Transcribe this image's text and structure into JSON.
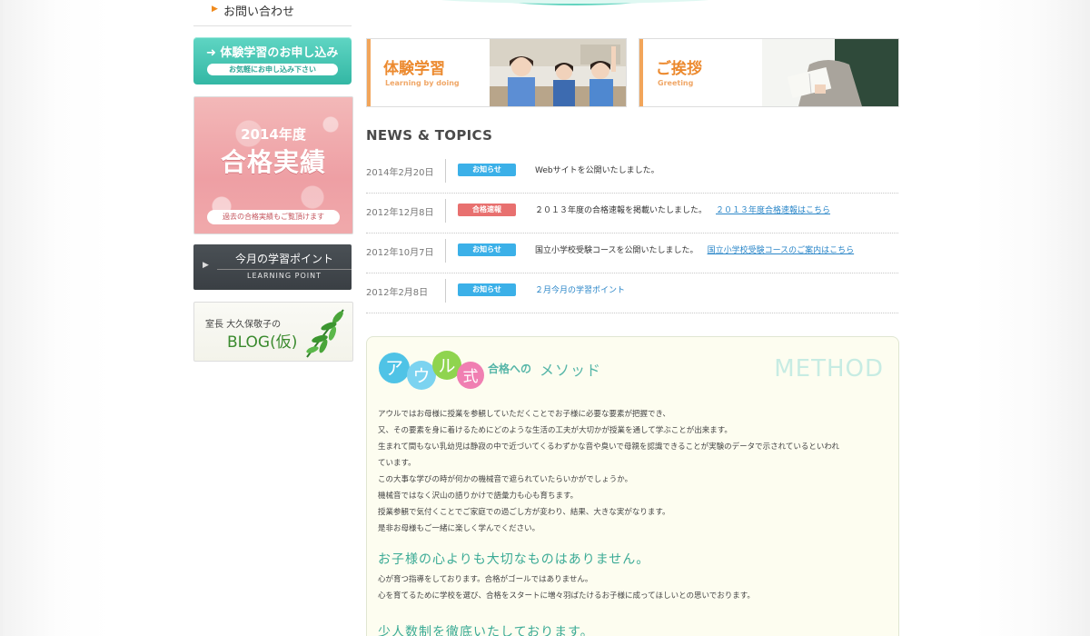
{
  "sidebar": {
    "contact_label": "お問い合わせ",
    "trial_button": {
      "title": "体験学習のお申し込み",
      "sub": "お気軽にお申し込み下さい"
    },
    "results": {
      "year": "2014年度",
      "title": "合格実績",
      "sub": "過去の合格実績もご覧頂けます"
    },
    "learning_point": {
      "title": "今月の学習ポイント",
      "sub": "LEARNING POINT"
    },
    "blog": {
      "title": "室長 大久保敬子の",
      "sub": "BLOG(仮)"
    }
  },
  "banners": [
    {
      "title": "体験学習",
      "sub": "Learning by doing"
    },
    {
      "title": "ご挨拶",
      "sub": "Greeting"
    }
  ],
  "news": {
    "title": "NEWS & TOPICS",
    "items": [
      {
        "date": "2014年2月20日",
        "badge": "お知らせ",
        "text": "Webサイトを公開いたしました。",
        "link": ""
      },
      {
        "date": "2012年12月8日",
        "badge": "合格速報",
        "text": "２０１３年度の合格速報を掲載いたしました。",
        "link": "２０１３年度合格速報はこちら"
      },
      {
        "date": "2012年10月7日",
        "badge": "お知らせ",
        "text": "国立小学校受験コースを公開いたしました。",
        "link": "国立小学校受験コースのご案内はこちら"
      },
      {
        "date": "2012年2月8日",
        "badge": "お知らせ",
        "text": "",
        "link": "２月今月の学習ポイント"
      }
    ]
  },
  "method": {
    "logo_chars": [
      "ア",
      "ウ",
      "ル",
      "式"
    ],
    "logo_sub": "合格への",
    "logo_sub2": "メソッド",
    "watermark": "METHOD",
    "paragraphs": [
      "アウルではお母様に授業を参観していただくことでお子様に必要な要素が把握でき、",
      "又、その要素を身に着けるためにどのような生活の工夫が大切かが授業を通して学ぶことが出来ます。",
      "生まれて間もない乳幼児は静寂の中で近づいてくるわずかな音や臭いで母親を認識できることが実験のデータで示されているといわれ",
      "ています。",
      "この大事な学びの時が何かの機械音で遮られていたらいかがでしょうか。",
      "機械音ではなく沢山の語りかけで語彙力も心も育ちます。",
      "授業参観で気付くことでご家庭での過ごし方が変わり、結果、大きな実がなります。",
      "是非お母様もご一緒に楽しく学んでください。"
    ],
    "heading1": "お子様の心よりも大切なものはありません。",
    "paragraphs2": [
      "心が育つ指導をしております。合格がゴールではありません。",
      "心を育てるために学校を選び、合格をスタートに増々羽ばたけるお子様に成ってほしいとの思いでおります。"
    ],
    "heading2": "少人数制を徹底いたしております。"
  },
  "colors": {
    "accent_teal": "#3aaa95",
    "accent_orange": "#ec8a2f",
    "badge_info": "#3bb0e8",
    "badge_result": "#e8706f",
    "link": "#2a86c8"
  }
}
